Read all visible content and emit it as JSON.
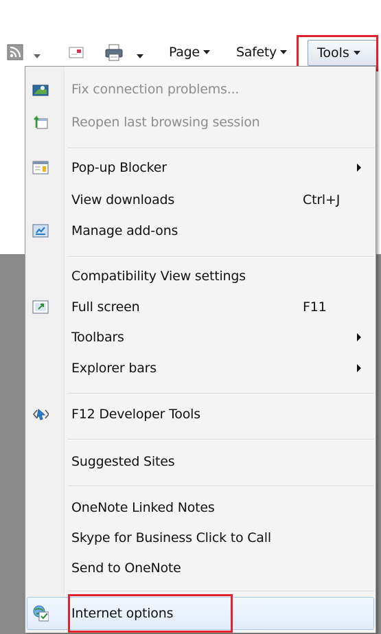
{
  "commandbar": {
    "page_label": "Page",
    "safety_label": "Safety",
    "tools_label": "Tools"
  },
  "menu": {
    "items": [
      {
        "label": "Fix connection problems...",
        "icon": "network-diagnose-icon",
        "disabled": true
      },
      {
        "label": "Reopen last browsing session",
        "icon": "reopen-session-icon",
        "disabled": true
      },
      {
        "label": "Pop-up Blocker",
        "icon": "popup-blocker-icon",
        "submenu": true
      },
      {
        "label": "View downloads",
        "shortcut": "Ctrl+J"
      },
      {
        "label": "Manage add-ons",
        "icon": "addons-icon"
      },
      {
        "label": "Compatibility View settings"
      },
      {
        "label": "Full screen",
        "icon": "fullscreen-icon",
        "shortcut": "F11"
      },
      {
        "label": "Toolbars",
        "submenu": true
      },
      {
        "label": "Explorer bars",
        "submenu": true
      },
      {
        "label": "F12 Developer Tools",
        "icon": "developer-tools-icon"
      },
      {
        "label": "Suggested Sites"
      },
      {
        "label": "OneNote Linked Notes"
      },
      {
        "label": "Skype for Business Click to Call"
      },
      {
        "label": "Send to OneNote"
      },
      {
        "label": "Internet options",
        "icon": "internet-options-icon",
        "hovered": true
      }
    ]
  },
  "colors": {
    "highlight_box": "#e0222e",
    "menu_background": "#f4f4f4",
    "disabled_text": "#8d8d8d",
    "hover_fill": "#e1ecfa"
  }
}
